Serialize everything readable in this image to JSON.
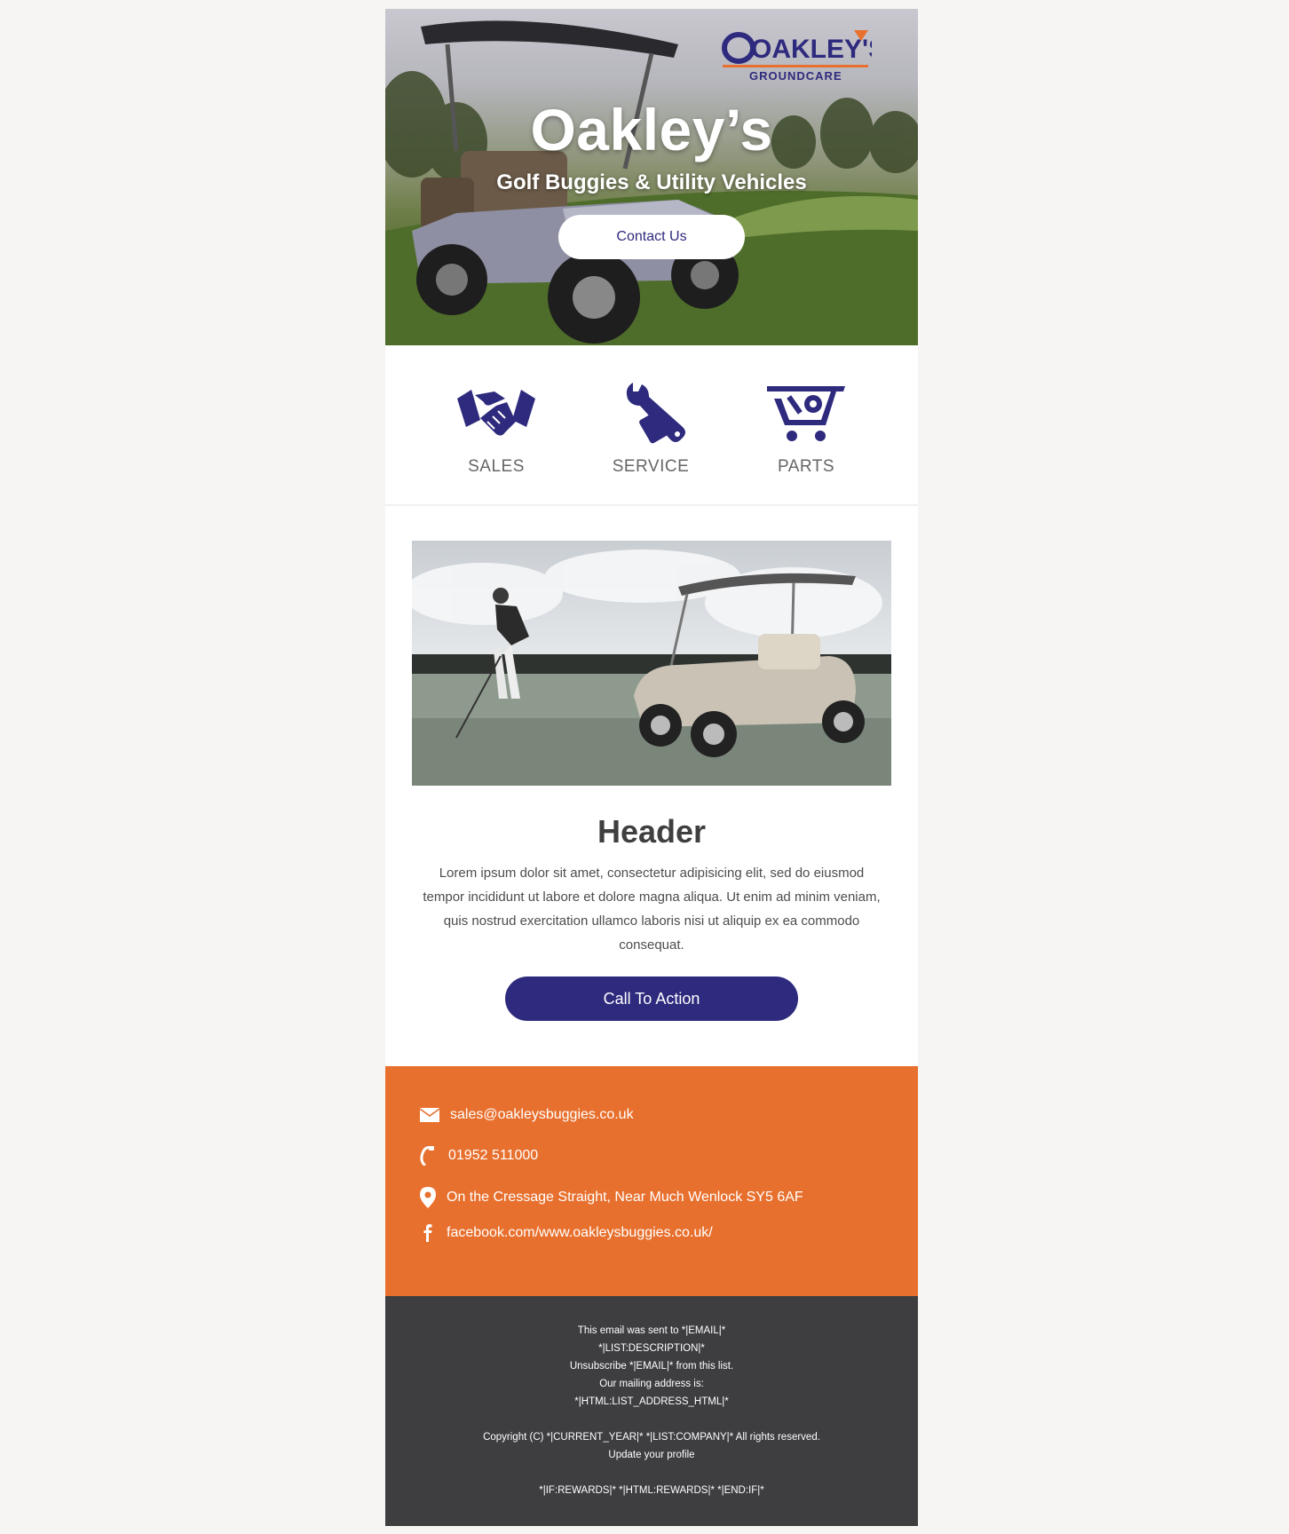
{
  "hero": {
    "logo_text": "OAKLEY'S",
    "logo_subtext": "GROUNDCARE",
    "title": "Oakley’s",
    "subtitle": "Golf Buggies & Utility Vehicles",
    "contact_button": "Contact Us"
  },
  "services": [
    {
      "label": "SALES",
      "icon": "handshake-icon"
    },
    {
      "label": "SERVICE",
      "icon": "wrench-icon"
    },
    {
      "label": "PARTS",
      "icon": "cart-icon"
    }
  ],
  "article": {
    "title": "Header",
    "body": "Lorem ipsum dolor sit amet, consectetur adipisicing elit, sed do eiusmod tempor incididunt ut labore et dolore magna aliqua. Ut enim ad minim veniam, quis nostrud exercitation ullamco laboris nisi ut aliquip ex ea commodo consequat.",
    "cta": "Call To Action"
  },
  "contact": {
    "email": "sales@oakleysbuggies.co.uk",
    "phone": "01952 511000",
    "address": "On the Cressage Straight, Near Much Wenlock SY5 6AF",
    "facebook": "facebook.com/www.oakleysbuggies.co.uk/"
  },
  "footer": {
    "line1": "This email was sent to *|EMAIL|*",
    "line2": "*|LIST:DESCRIPTION|*",
    "line3": "Unsubscribe *|EMAIL|* from this list.",
    "line4": "Our mailing address is:",
    "line5": "*|HTML:LIST_ADDRESS_HTML|*",
    "line6": "Copyright (C) *|CURRENT_YEAR|* *|LIST:COMPANY|* All rights reserved.",
    "line7": "Update your profile",
    "line8": "*|IF:REWARDS|* *|HTML:REWARDS|* *|END:IF|*"
  },
  "colors": {
    "brand_blue": "#2e2a7d",
    "brand_orange": "#e8702e",
    "footer_bg": "#3e3d40",
    "page_bg": "#f6f5f3"
  }
}
